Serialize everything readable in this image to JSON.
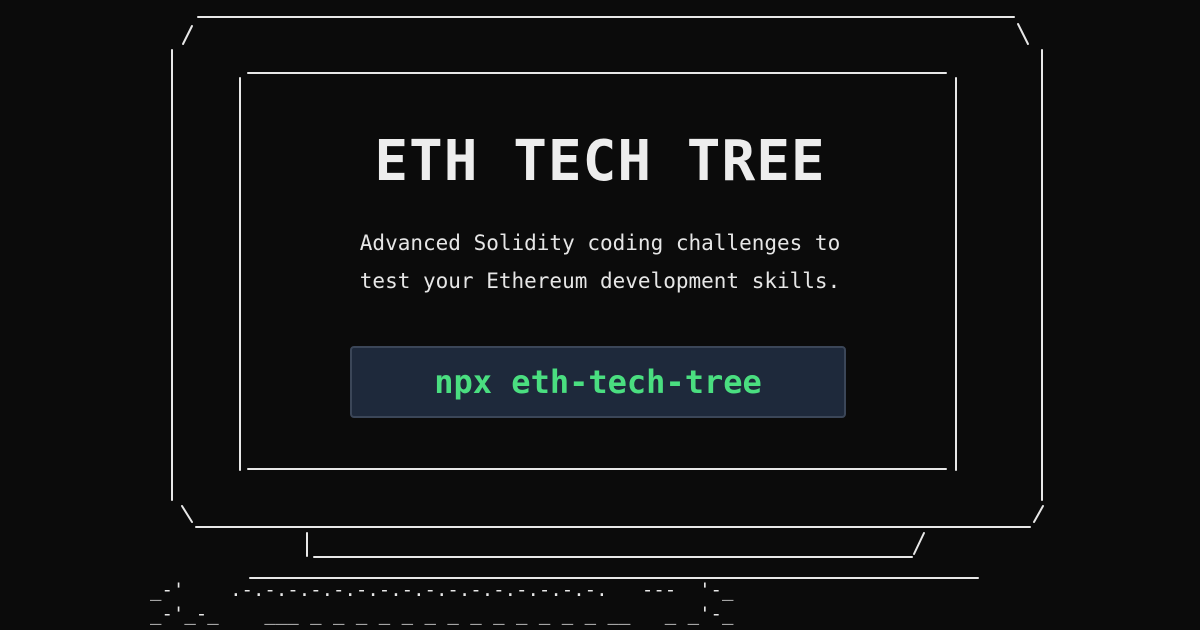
{
  "card": {
    "title": "ETH TECH TREE",
    "subtitle_line1": "Advanced Solidity coding challenges to",
    "subtitle_line2": "test your Ethereum development skills.",
    "command": "npx eth-tech-tree"
  },
  "keyboard_ascii": {
    "row1": "_-'    .-.-.-.-.-.-.-.-.-.-.-.-.-.-.-.-.   ---  '-_",
    "row2": "_-'_-_    ___ _ _ _ _ _ _ _ _ _ _ _ _ _ __   _ _'-_"
  },
  "colors": {
    "background": "#0b0b0b",
    "line": "#e8e8e8",
    "title": "#ededed",
    "command_bg": "#1e293b",
    "command_border": "#3b4658",
    "command_text": "#4ade80"
  }
}
